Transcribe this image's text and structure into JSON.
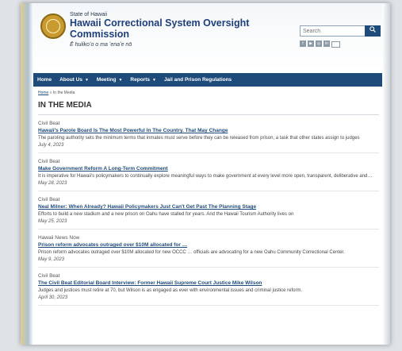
{
  "header": {
    "state": "State of Hawaii",
    "title": "Hawaii Correctional System Oversight Commission",
    "tagline": "Ē hulikoʻo o ma ʻenaʻe nō",
    "search_placeholder": "Search",
    "search_icon": "search-icon",
    "social_icons": [
      "facebook-icon",
      "youtube-icon",
      "instagram-icon",
      "linkedin-icon",
      "email-icon"
    ]
  },
  "nav": {
    "home": "Home",
    "about": "About Us",
    "meeting": "Meeting",
    "reports": "Reports",
    "jail": "Jail and Prison Regulations"
  },
  "breadcrumb": {
    "home": "Home",
    "separator": "»",
    "current": "In the Media"
  },
  "page_title": "IN THE MEDIA",
  "articles": [
    {
      "source": "Civil Beat",
      "headline": "Hawaii's Parole Board Is The Most Powerful In The Country. That May Change",
      "summary": "The paroling authority sets the minimum terms that inmates must serve before they can be released from prison, a task that other states assign to judges",
      "date": "July 4, 2023"
    },
    {
      "source": "Civil Beat",
      "headline": "Make Government Reform A Long-Term Commitment",
      "summary": "It is imperative for Hawaii's policymakers to continually explore meaningful ways to make government at every level more open, transparent, deliberative and…",
      "date": "May 28, 2023"
    },
    {
      "source": "Civil Beat",
      "headline": "Neal Milner: When Already? Hawaii Policymakers Just Can't Get Past The Planning Stage",
      "summary": "Efforts to build a new stadium and a new prison on Oahu have stalled for years. And the Hawaii Tourism Authority lives on",
      "date": "May 25, 2023"
    },
    {
      "source": "Hawaii News Now",
      "headline": "Prison reform advocates outraged over $10M allocated for …",
      "summary": "Prison reform advocates outraged over $10M allocated for new OCCC … officials are advocating for a new Oahu Community Correctional Center.",
      "date": "May 9, 2023"
    },
    {
      "source": "Civil Beat",
      "headline": "The Civil Beat Editorial Board Interview: Former Hawaii Supreme Court Justice Mike Wilson",
      "summary": "Judges and justices must retire at 70, but Wilson is as engaged as ever with environmental issues and criminal justice reform.",
      "date": "April 30, 2023"
    }
  ]
}
